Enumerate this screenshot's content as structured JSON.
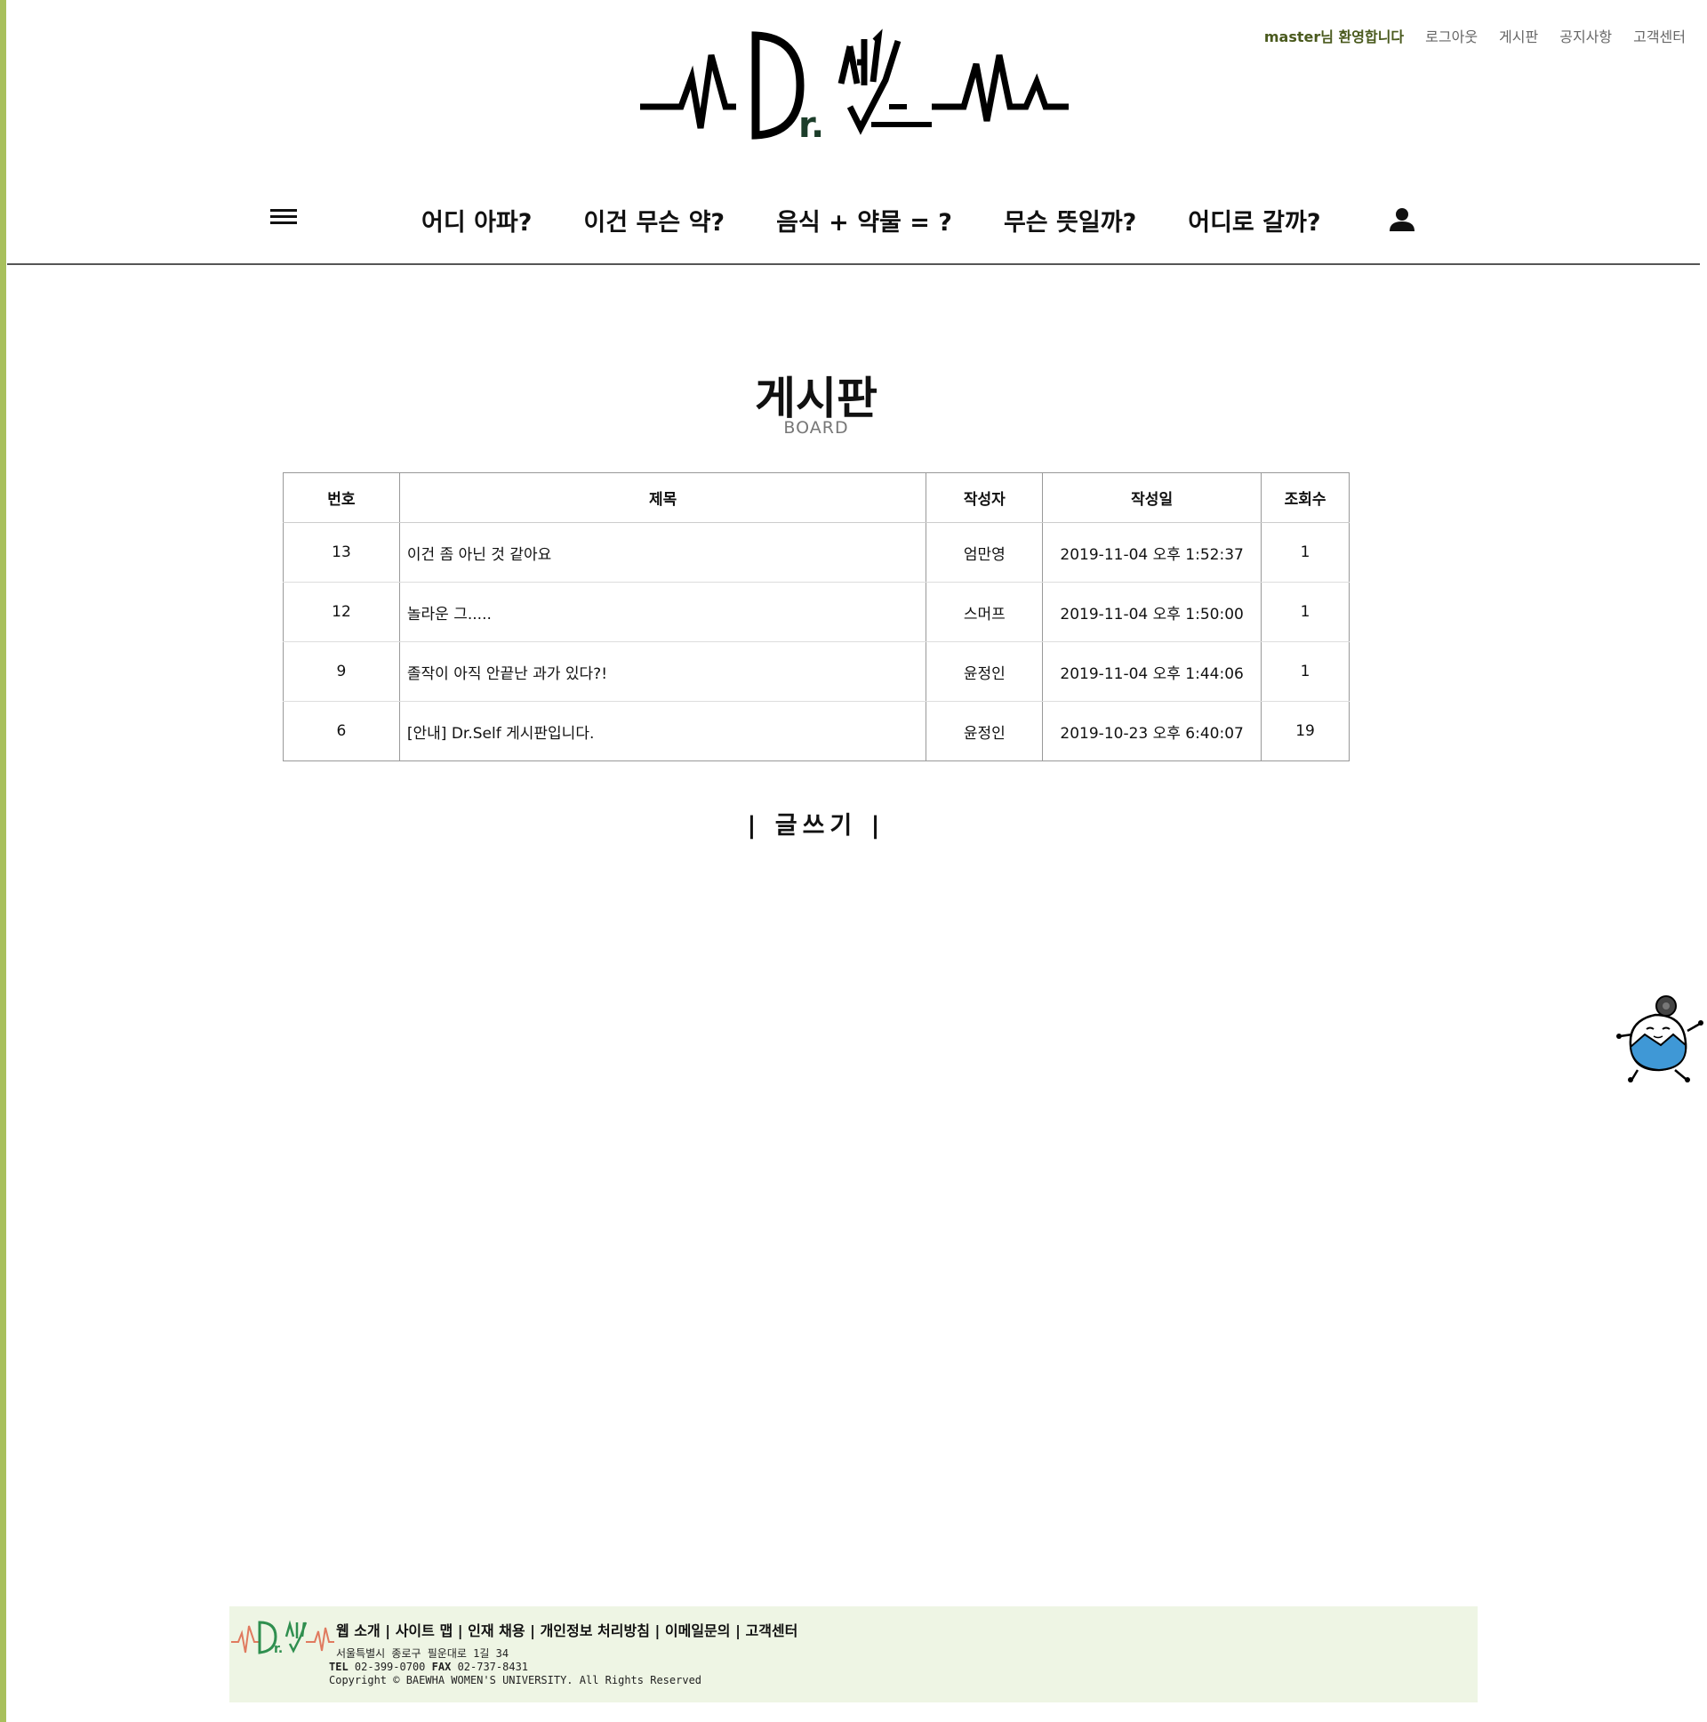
{
  "topbar": {
    "welcome": "master님 환영합니다",
    "logout": "로그아웃",
    "board": "게시판",
    "notice": "공지사항",
    "support": "고객센터"
  },
  "logo": {
    "text": "Dr.셀프"
  },
  "nav": {
    "items": [
      "어디 아파?",
      "이건 무슨 약?",
      "음식 + 약물 = ?",
      "무슨 뜻일까?",
      "어디로 갈까?"
    ]
  },
  "page": {
    "title": "게시판",
    "subtitle": "BOARD"
  },
  "table": {
    "headers": {
      "no": "번호",
      "title": "제목",
      "author": "작성자",
      "date": "작성일",
      "views": "조회수"
    },
    "rows": [
      {
        "no": "13",
        "title": "이건 좀 아닌 것 같아요",
        "author": "엄만영",
        "date": "2019-11-04 오후 1:52:37",
        "views": "1"
      },
      {
        "no": "12",
        "title": "놀라운 그.....",
        "author": "스머프",
        "date": "2019-11-04 오후 1:50:00",
        "views": "1"
      },
      {
        "no": "9",
        "title": "졸작이 아직 안끝난 과가 있다?!",
        "author": "윤정인",
        "date": "2019-11-04 오후 1:44:06",
        "views": "1"
      },
      {
        "no": "6",
        "title": "[안내] Dr.Self 게시판입니다.",
        "author": "윤정인",
        "date": "2019-10-23 오후 6:40:07",
        "views": "19"
      }
    ]
  },
  "write_button": "| 글쓰기 |",
  "footer": {
    "links": "웹 소개 | 사이트 맵 | 인재 채용 | 개인정보 처리방침 | 이메일문의 | 고객센터",
    "address": "서울특별시 종로구 필운대로 1길 34",
    "tel_label": "TEL",
    "tel": "02-399-0700",
    "fax_label": "FAX",
    "fax": "02-737-8431",
    "copyright": "Copyright © BAEWHA WOMEN'S UNIVERSITY. All Rights Reserved"
  },
  "colors": {
    "accent": "#a8c05c",
    "welcome": "#4a5a1e",
    "footer_bg": "#eef5e4"
  }
}
